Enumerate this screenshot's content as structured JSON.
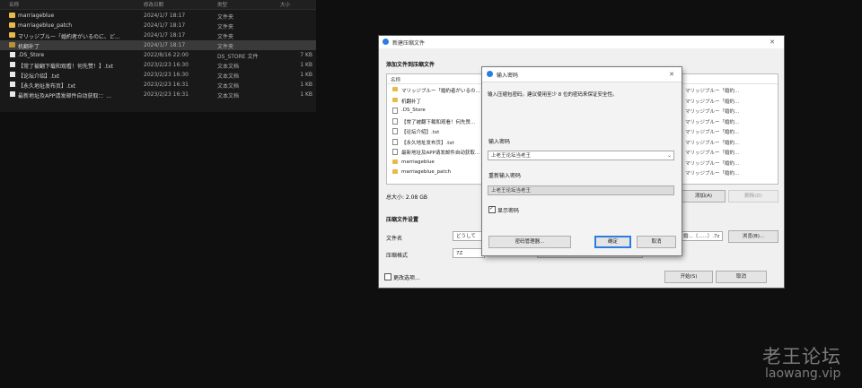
{
  "explorer": {
    "headers": {
      "name": "名称",
      "date": "修改日期",
      "type": "类型",
      "size": "大小"
    },
    "rows": [
      {
        "name": "marriageblue",
        "date": "2024/1/7 18:17",
        "type": "文件夹",
        "size": "",
        "icon": "folder-icon"
      },
      {
        "name": "marriageblue_patch",
        "date": "2024/1/7 18:17",
        "type": "文件夹",
        "size": "",
        "icon": "folder-icon"
      },
      {
        "name": "マリッジブルー「婚約者がいるのに、ど...",
        "date": "2024/1/7 18:17",
        "type": "文件夹",
        "size": "",
        "icon": "folder-icon"
      },
      {
        "name": "机翻补丁",
        "date": "2024/1/7 18:17",
        "type": "文件夹",
        "size": "",
        "icon": "folder-icon"
      },
      {
        "name": ".DS_Store",
        "date": "2022/8/16 22:00",
        "type": "DS_STORE 文件",
        "size": "7 KB",
        "icon": "file-icon"
      },
      {
        "name": "【常了被翻下载和观看！何先赞！】.txt",
        "date": "2023/2/23 16:30",
        "type": "文本文档",
        "size": "1 KB",
        "icon": "file-icon"
      },
      {
        "name": "【论坛介绍】.txt",
        "date": "2023/2/23 16:30",
        "type": "文本文档",
        "size": "1 KB",
        "icon": "file-icon"
      },
      {
        "name": "【永久地址发布页】.txt",
        "date": "2023/2/23 16:31",
        "type": "文本文档",
        "size": "1 KB",
        "icon": "file-icon"
      },
      {
        "name": "最新地址及APP请发邮件自动获取：：...",
        "date": "2023/2/23 16:31",
        "type": "文本文档",
        "size": "1 KB",
        "icon": "file-icon"
      }
    ]
  },
  "main_dialog": {
    "title": "新建压缩文件",
    "section_add": "添加文件到压缩文件",
    "list_header": "名称",
    "list_rows": [
      {
        "name": "マリッジブルー「婚約者がいるの...",
        "right": "マリッジブルー「婚約..."
      },
      {
        "name": "机翻补丁",
        "right": "マリッジブルー「婚約..."
      },
      {
        "name": ".DS_Store",
        "right": "マリッジブルー「婚約..."
      },
      {
        "name": "【常了被翻下载和观看！何先赞...",
        "right": "マリッジブルー「婚約..."
      },
      {
        "name": "【论坛介绍】.txt",
        "right": "マリッジブルー「婚約..."
      },
      {
        "name": "【永久地址发布页】.txt",
        "right": "マリッジブルー「婚約..."
      },
      {
        "name": "最新地址及APP请发邮件自动获取...",
        "right": "マリッジブルー「婚約..."
      },
      {
        "name": "marriageblue",
        "right": "マリッジブルー「婚約..."
      },
      {
        "name": "marriageblue_patch",
        "right": "マリッジブルー「婚約..."
      }
    ],
    "total_size": "总大小: 2.08 GB",
    "add_button": "添加(A)",
    "remove_button": "删除(D)",
    "section_settings": "压缩文件设置",
    "filename_label": "文件名",
    "filename_value": "どうして",
    "filename_right": "婚...（......）.7z",
    "browse_button": "浏览(B)...",
    "format_label": "压缩格式",
    "format_value": "7Z",
    "more_options": "更改选项...",
    "start_button": "开始(S)",
    "cancel_button": "取消"
  },
  "password_dialog": {
    "title": "输入密码",
    "hint": "输入压缩包密码。建议使用至少 8 位的密码来保证安全性。",
    "password_label": "输入密码",
    "password_value": "上老王论坛当老王",
    "confirm_label": "重新输入密码",
    "confirm_value": "上老王论坛当老王",
    "show_password": "显示密码",
    "manager_button": "密码管理器...",
    "ok_button": "确定",
    "cancel_button": "取消"
  },
  "watermark": {
    "line1": "老王论坛",
    "line2": "laowang.vip"
  }
}
